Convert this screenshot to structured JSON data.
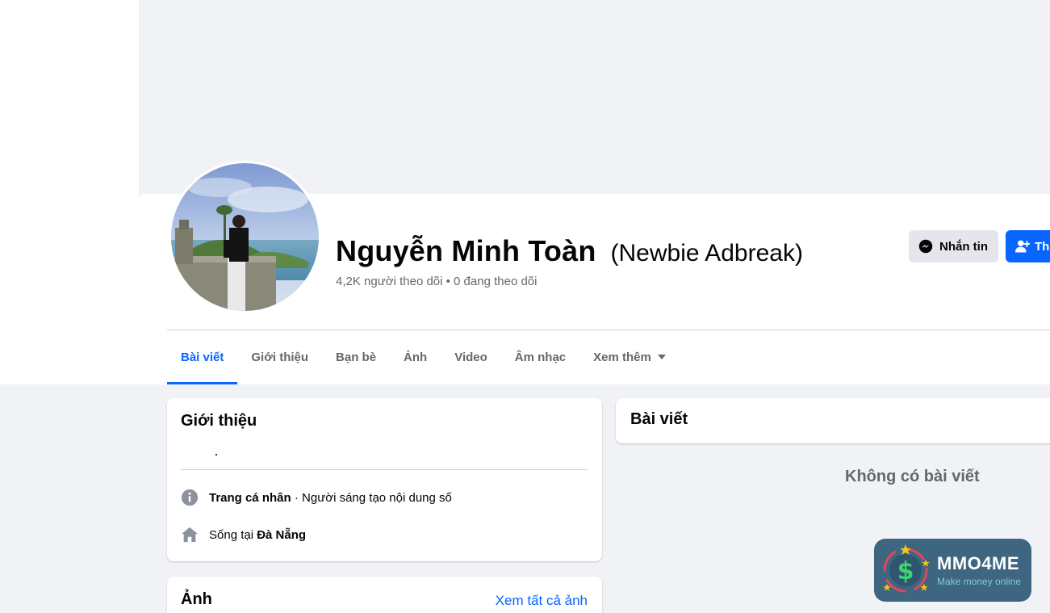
{
  "profile": {
    "name": "Nguyễn Minh Toàn",
    "alternate_name": "(Newbie Adbreak)",
    "stats": "4,2K người theo dõi • 0 đang theo dõi"
  },
  "actions": {
    "message_label": "Nhắn tin",
    "add_friend_label": "Th"
  },
  "tabs": [
    {
      "label": "Bài viết",
      "active": true
    },
    {
      "label": "Giới thiệu"
    },
    {
      "label": "Bạn bè"
    },
    {
      "label": "Ảnh"
    },
    {
      "label": "Video"
    },
    {
      "label": "Âm nhạc"
    },
    {
      "label": "Xem thêm"
    }
  ],
  "intro": {
    "title": "Giới thiệu",
    "rows": [
      {
        "icon": "info-icon",
        "bold": "Trang cá nhân",
        "text": " · Người sáng tạo nội dung số"
      },
      {
        "icon": "home-icon",
        "text": "Sống tại ",
        "bold": "Đà Nẵng"
      }
    ]
  },
  "photos": {
    "title": "Ảnh",
    "see_all": "Xem tất cả ảnh"
  },
  "posts": {
    "title": "Bài viết",
    "empty": "Không có bài viết"
  },
  "watermark": {
    "brand": "MMO4ME",
    "tagline": "Make money online"
  },
  "colors": {
    "accent": "#0866ff",
    "secondary_text": "#65676b",
    "background": "#f0f2f5"
  }
}
